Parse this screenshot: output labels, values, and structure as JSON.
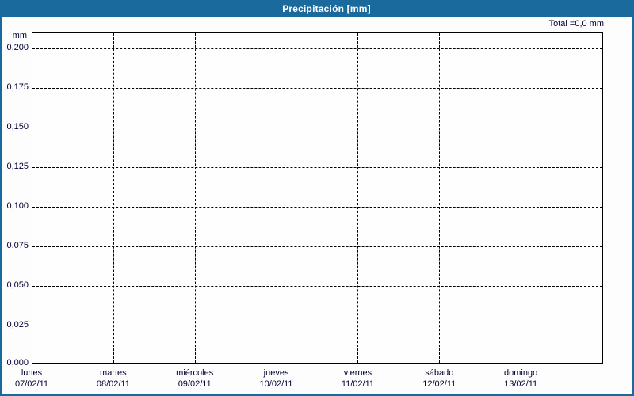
{
  "title": "Precipitación [mm]",
  "total_label": "Total =0,0 mm",
  "y_axis_unit": "mm",
  "colors": {
    "accent_blue": "#1a6a9e",
    "title_text": "#ffffff",
    "grid": "#000000",
    "label_text": "#000033",
    "background": "#fdfdfd",
    "plot_background": "#fefefe"
  },
  "chart_data": {
    "type": "bar",
    "title": "Precipitación [mm]",
    "ylabel": "mm",
    "ylim": [
      0,
      0.21
    ],
    "grid": "dashed",
    "legend": "none",
    "total_mm": "0,0",
    "y_ticks": [
      "0,200",
      "0,175",
      "0,150",
      "0,125",
      "0,100",
      "0,075",
      "0,050",
      "0,025",
      "0,000"
    ],
    "categories": [
      {
        "day": "lunes",
        "date": "07/02/11"
      },
      {
        "day": "martes",
        "date": "08/02/11"
      },
      {
        "day": "miércoles",
        "date": "09/02/11"
      },
      {
        "day": "jueves",
        "date": "10/02/11"
      },
      {
        "day": "viernes",
        "date": "11/02/11"
      },
      {
        "day": "sábado",
        "date": "12/02/11"
      },
      {
        "day": "domingo",
        "date": "13/02/11"
      }
    ],
    "values": [
      0,
      0,
      0,
      0,
      0,
      0,
      0
    ]
  }
}
